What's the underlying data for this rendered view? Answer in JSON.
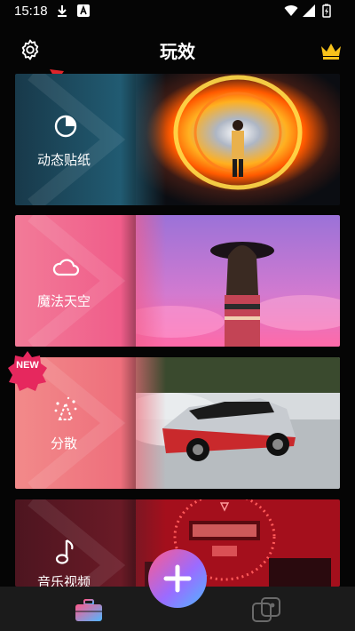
{
  "status_bar": {
    "time": "15:18"
  },
  "header": {
    "title": "玩效"
  },
  "cards": [
    {
      "label": "动态贴纸",
      "icon": "sticker-icon"
    },
    {
      "label": "魔法天空",
      "icon": "cloud-icon"
    },
    {
      "label": "分散",
      "icon": "scatter-icon",
      "badge": "NEW"
    },
    {
      "label": "音乐视频",
      "icon": "music-note-icon"
    }
  ],
  "colors": {
    "accent_gold": "#f7c21b",
    "arrow_red": "#e0242a",
    "card1_left": "#1e4b5f",
    "card2_left": "#f06a8f",
    "card3_left": "#ef7f86",
    "card4_left": "#5b1822"
  }
}
